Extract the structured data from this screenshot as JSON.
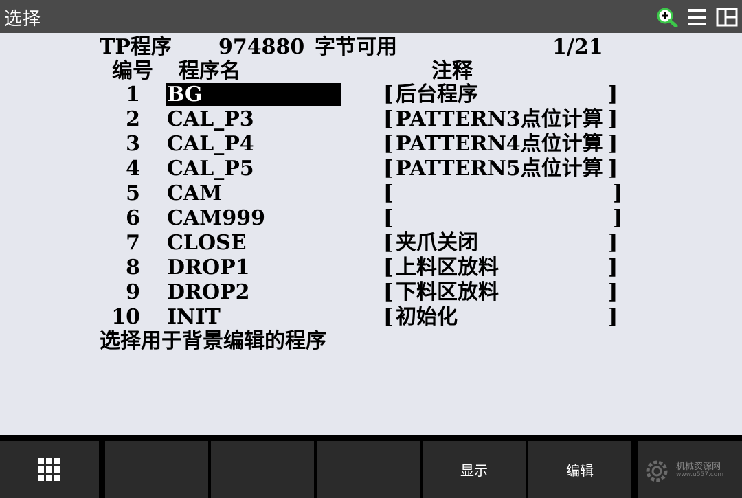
{
  "titlebar": {
    "title": "选择",
    "icons": [
      "zoom-in-icon",
      "menu-icon",
      "split-view-icon"
    ]
  },
  "header": {
    "label": "TP程序",
    "bytes": "974880",
    "bytes_suffix": "字节可用",
    "page": "1/21"
  },
  "columns": {
    "number": "编号",
    "name": "程序名",
    "comment": "注释"
  },
  "programs": [
    {
      "no": "1",
      "name": "BG",
      "comment": "后台程序",
      "selected": true
    },
    {
      "no": "2",
      "name": "CAL_P3",
      "comment": "PATTERN3点位计算",
      "selected": false
    },
    {
      "no": "3",
      "name": "CAL_P4",
      "comment": "PATTERN4点位计算",
      "selected": false
    },
    {
      "no": "4",
      "name": "CAL_P5",
      "comment": "PATTERN5点位计算",
      "selected": false
    },
    {
      "no": "5",
      "name": "CAM",
      "comment": "",
      "selected": false
    },
    {
      "no": "6",
      "name": "CAM999",
      "comment": "",
      "selected": false
    },
    {
      "no": "7",
      "name": "CLOSE",
      "comment": "夹爪关闭",
      "selected": false
    },
    {
      "no": "8",
      "name": "DROP1",
      "comment": "上料区放料",
      "selected": false
    },
    {
      "no": "9",
      "name": "DROP2",
      "comment": "下料区放料",
      "selected": false
    },
    {
      "no": "10",
      "name": "INIT",
      "comment": "初始化",
      "selected": false
    }
  ],
  "prompt": "选择用于背景编辑的程序",
  "function_keys": {
    "f1": "",
    "f2": "",
    "f3": "",
    "f4": "显示",
    "f5": "编辑"
  },
  "watermark": {
    "line1": "机械资源网",
    "line2": "www.u557.com"
  },
  "colors": {
    "titlebar": "#4a4a4a",
    "screen": "#e5e7ee",
    "fkey": "#2b2b2b",
    "selection": "#000000",
    "zoom_icon": "#3cc84a"
  }
}
